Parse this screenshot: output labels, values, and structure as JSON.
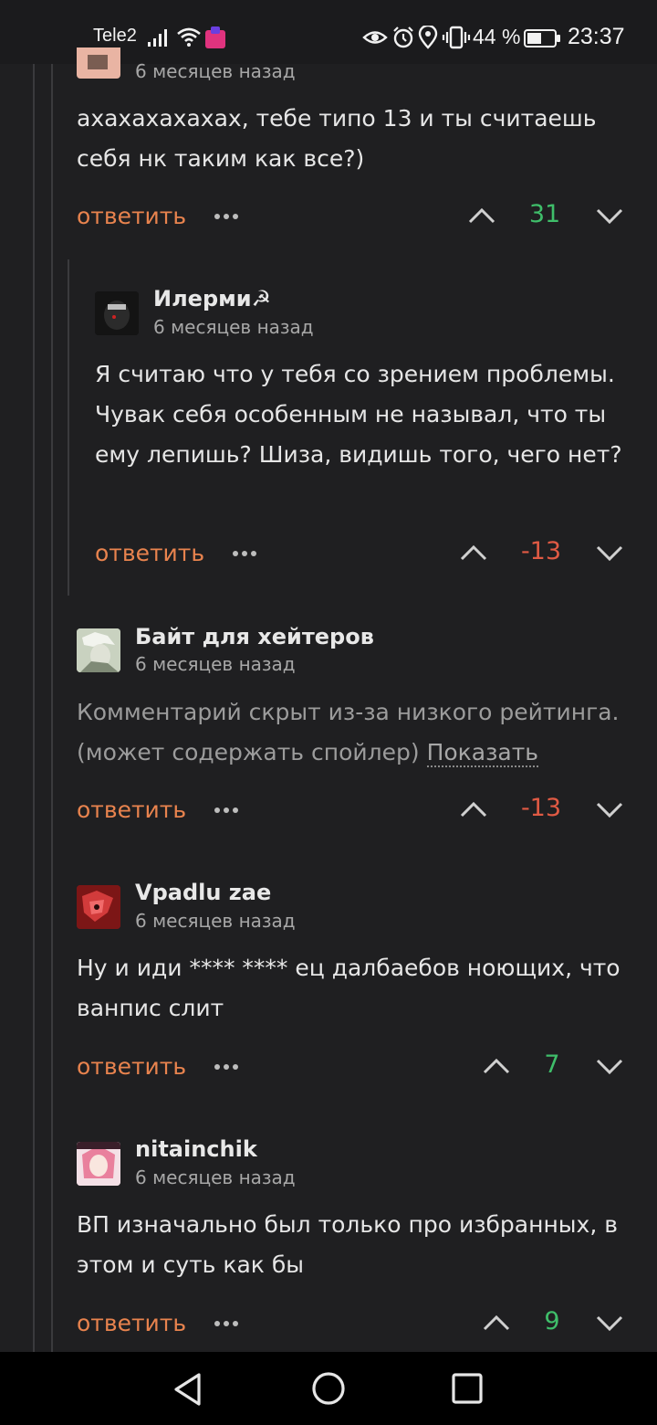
{
  "status_bar": {
    "carrier": "Tele2",
    "battery_percent": "44 %",
    "time": "23:37",
    "icons": [
      "signal-icon",
      "wifi-icon",
      "app-notification-icon",
      "eye-icon",
      "alarm-icon",
      "location-icon",
      "vibrate-icon",
      "battery-icon"
    ]
  },
  "comments": [
    {
      "date": "6 месяцев назад",
      "text": "ахахахахахах, тебе типо 13 и ты считаешь себя нк таким как все?)",
      "reply_label": "ответить",
      "score": "31"
    },
    {
      "author": "Илерми☭",
      "date": "6 месяцев назад",
      "text": "Я считаю что у тебя со зрением проблемы. Чувак себя особенным не называл, что ты ему лепишь? Шиза, видишь того, чего нет?",
      "reply_label": "ответить",
      "score": "-13"
    },
    {
      "author": "Байт для хейтеров",
      "date": "6 месяцев назад",
      "text": "Комментарий скрыт из-за низкого рейтинга. (может содержать спойлер)",
      "show_label": "Показать",
      "reply_label": "ответить",
      "score": "-13"
    },
    {
      "author": "Vpadlu zae",
      "date": "6 месяцев назад",
      "text": "Ну и иди **** **** ец далбаебов ноющих, что ванпис слит",
      "reply_label": "ответить",
      "score": "7"
    },
    {
      "author": "nitainchik",
      "date": "6 месяцев назад",
      "text": "ВП изначально был только про избранных, в этом и суть как бы",
      "reply_label": "ответить",
      "score": "9"
    }
  ],
  "colors": {
    "background": "#1f1f21",
    "reply_accent": "#e8834e",
    "score_positive": "#3fbe6a",
    "score_negative": "#e05a44"
  },
  "nav_bar": {
    "icons": [
      "back-icon",
      "home-icon",
      "recents-icon"
    ]
  }
}
